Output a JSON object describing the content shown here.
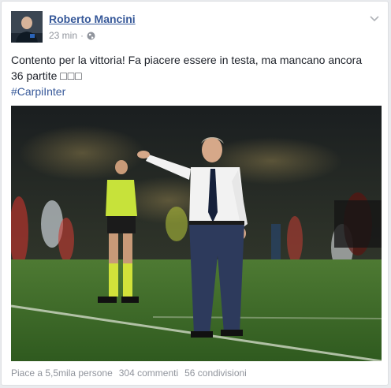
{
  "post": {
    "author": "Roberto Mancini",
    "time": "23 min",
    "separator": "·",
    "text_line1": "Contento per la vittoria! Fa piacere essere in testa, ma mancano ancora",
    "text_line2": "36 partite",
    "emojis": "□□□",
    "hashtag": "#CarpiInter"
  },
  "stats": {
    "likes": "Piace a 5,5mila persone",
    "comments": "304 commenti",
    "shares": "56 condivisioni"
  },
  "colors": {
    "link": "#365899",
    "muted": "#90949c",
    "pitch": "#3b6a27"
  },
  "icons": [
    "globe-icon",
    "chevron-down-icon"
  ]
}
